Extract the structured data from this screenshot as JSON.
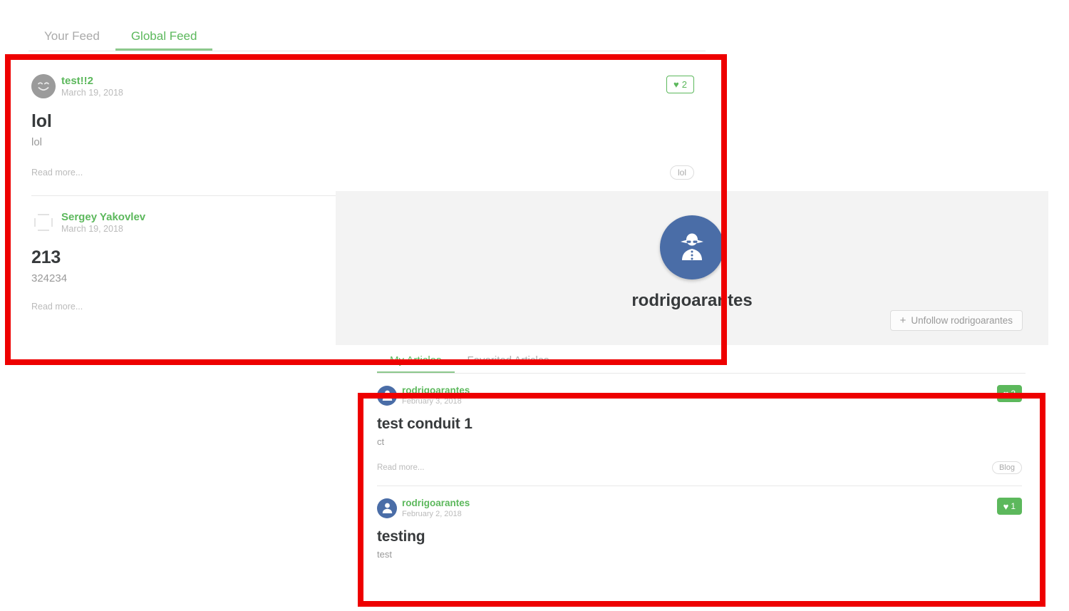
{
  "feed": {
    "tabs": [
      {
        "label": "Your Feed",
        "active": false
      },
      {
        "label": "Global Feed",
        "active": true
      }
    ],
    "articles": [
      {
        "author": "test!!2",
        "date": "March 19, 2018",
        "title": "lol",
        "description": "lol",
        "read_more": "Read more...",
        "tag": "lol",
        "favorites": "2",
        "favorited": false,
        "avatar_icon": "smiley-face-icon"
      },
      {
        "author": "Sergey Yakovlev",
        "date": "March 19, 2018",
        "title": "213",
        "description": "324234",
        "read_more": "Read more...",
        "tag": "",
        "favorites": "",
        "favorited": false,
        "avatar_icon": "broken-image-icon"
      }
    ]
  },
  "profile": {
    "username": "rodrigoarantes",
    "avatar_icon": "incognito-user-icon",
    "follow_button": {
      "label": "Unfollow rodrigoarantes",
      "icon": "plus-icon"
    },
    "tabs": [
      {
        "label": "My Articles",
        "active": true
      },
      {
        "label": "Favorited Articles",
        "active": false
      }
    ],
    "articles": [
      {
        "author": "rodrigoarantes",
        "date": "February 3, 2018",
        "title": "test conduit 1",
        "description": "ct",
        "read_more": "Read more...",
        "tag": "Blog",
        "favorites": "2",
        "favorited": true,
        "avatar_icon": "user-circle-icon"
      },
      {
        "author": "rodrigoarantes",
        "date": "February 2, 2018",
        "title": "testing",
        "description": "test",
        "read_more": "",
        "tag": "",
        "favorites": "1",
        "favorited": true,
        "avatar_icon": "user-circle-icon"
      }
    ]
  },
  "annotations": {
    "highlight_color": "#ee0000",
    "boxes": [
      {
        "name": "global-feed-article-list-highlight"
      },
      {
        "name": "profile-article-list-highlight"
      }
    ]
  },
  "colors": {
    "brand_green": "#5cb85c",
    "muted_text": "#bbbbbb",
    "title_text": "#373a3c",
    "banner_gray": "#f3f3f3",
    "avatar_blue": "#4a6da7"
  },
  "icons": {
    "heart": "♥",
    "plus": "+"
  }
}
